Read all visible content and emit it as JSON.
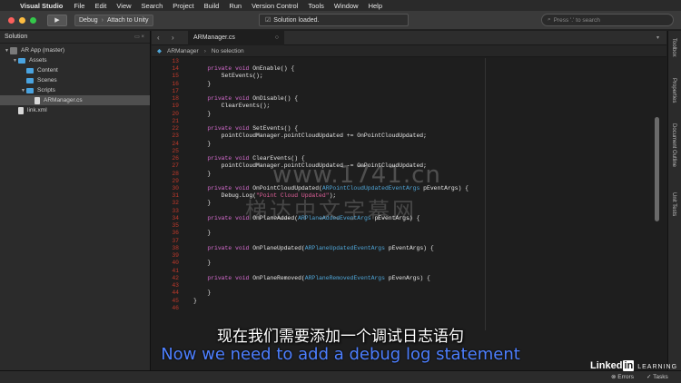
{
  "menubar": {
    "app": "Visual Studio",
    "items": [
      "File",
      "Edit",
      "View",
      "Search",
      "Project",
      "Build",
      "Run",
      "Version Control",
      "Tools",
      "Window",
      "Help"
    ]
  },
  "toolbar": {
    "config": "Debug",
    "target": "Attach to Unity",
    "status": "Solution loaded.",
    "search_placeholder": "Press '.' to search",
    "colors": {
      "close": "#fc605c",
      "minimize": "#fdbc40",
      "maximize": "#34c84a"
    }
  },
  "solution": {
    "title": "Solution",
    "items": [
      {
        "label": "AR App (master)",
        "indent": 0,
        "icon": "solution-icon",
        "twisty": "▼"
      },
      {
        "label": "Assets",
        "indent": 1,
        "icon": "folder-icon",
        "twisty": "▼"
      },
      {
        "label": "Content",
        "indent": 2,
        "icon": "folder-icon",
        "twisty": ""
      },
      {
        "label": "Scenes",
        "indent": 2,
        "icon": "folder-icon",
        "twisty": ""
      },
      {
        "label": "Scripts",
        "indent": 2,
        "icon": "folder-icon",
        "twisty": "▼"
      },
      {
        "label": "ARManager.cs",
        "indent": 3,
        "icon": "file-icon",
        "twisty": "",
        "selected": true
      },
      {
        "label": "link.xml",
        "indent": 1,
        "icon": "file-icon",
        "twisty": ""
      }
    ]
  },
  "editor": {
    "tab": "ARManager.cs",
    "path_class": "ARManager",
    "path_member": "No selection",
    "lines": [
      {
        "n": "13",
        "t": []
      },
      {
        "n": "14",
        "t": [
          [
            "    ",
            "src"
          ],
          [
            "private void",
            "kw"
          ],
          [
            " OnEnable() {",
            "src"
          ]
        ]
      },
      {
        "n": "15",
        "t": [
          [
            "        SetEvents();",
            "src"
          ]
        ]
      },
      {
        "n": "16",
        "t": [
          [
            "    }",
            "src"
          ]
        ]
      },
      {
        "n": "17",
        "t": []
      },
      {
        "n": "18",
        "t": [
          [
            "    ",
            "src"
          ],
          [
            "private void",
            "kw"
          ],
          [
            " OnDisable() {",
            "src"
          ]
        ]
      },
      {
        "n": "19",
        "t": [
          [
            "        ClearEvents();",
            "src"
          ]
        ]
      },
      {
        "n": "20",
        "t": [
          [
            "    }",
            "src"
          ]
        ]
      },
      {
        "n": "21",
        "t": []
      },
      {
        "n": "22",
        "t": [
          [
            "    ",
            "src"
          ],
          [
            "private void",
            "kw"
          ],
          [
            " SetEvents() {",
            "src"
          ]
        ]
      },
      {
        "n": "23",
        "t": [
          [
            "        pointCloudManager.pointCloudUpdated += OnPointCloudUpdated;",
            "src"
          ]
        ]
      },
      {
        "n": "24",
        "t": [
          [
            "    }",
            "src"
          ]
        ]
      },
      {
        "n": "25",
        "t": []
      },
      {
        "n": "26",
        "t": [
          [
            "    ",
            "src"
          ],
          [
            "private void",
            "kw"
          ],
          [
            " ClearEvents() {",
            "src"
          ]
        ]
      },
      {
        "n": "27",
        "t": [
          [
            "        pointCloudManager.pointCloudUpdated -= OnPointCloudUpdated;",
            "src"
          ]
        ]
      },
      {
        "n": "28",
        "t": [
          [
            "    }",
            "src"
          ]
        ]
      },
      {
        "n": "29",
        "t": []
      },
      {
        "n": "30",
        "t": [
          [
            "    ",
            "src"
          ],
          [
            "private void",
            "kw"
          ],
          [
            " OnPointCloudUpdated(",
            "src"
          ],
          [
            "ARPointCloudUpdatedEventArgs",
            "type"
          ],
          [
            " pEventArgs) {",
            "src"
          ]
        ]
      },
      {
        "n": "31",
        "t": [
          [
            "        Debug.Log(",
            "src"
          ],
          [
            "\"Point Cloud Updated\"",
            "str"
          ],
          [
            ");",
            "src"
          ]
        ]
      },
      {
        "n": "32",
        "t": [
          [
            "    }",
            "src"
          ]
        ]
      },
      {
        "n": "33",
        "t": []
      },
      {
        "n": "34",
        "t": [
          [
            "    ",
            "src"
          ],
          [
            "private void",
            "kw"
          ],
          [
            " OnPlaneAdded(",
            "src"
          ],
          [
            "ARPlaneAddedEventArgs",
            "type"
          ],
          [
            " pEventArgs) {",
            "src"
          ]
        ]
      },
      {
        "n": "35",
        "t": []
      },
      {
        "n": "36",
        "t": [
          [
            "    }",
            "src"
          ]
        ]
      },
      {
        "n": "37",
        "t": []
      },
      {
        "n": "38",
        "t": [
          [
            "    ",
            "src"
          ],
          [
            "private void",
            "kw"
          ],
          [
            " OnPlaneUpdated(",
            "src"
          ],
          [
            "ARPlaneUpdatedEventArgs",
            "type"
          ],
          [
            " pEventArgs) {",
            "src"
          ]
        ]
      },
      {
        "n": "39",
        "t": []
      },
      {
        "n": "40",
        "t": [
          [
            "    }",
            "src"
          ]
        ]
      },
      {
        "n": "41",
        "t": []
      },
      {
        "n": "42",
        "t": [
          [
            "    ",
            "src"
          ],
          [
            "private void",
            "kw"
          ],
          [
            " OnPlaneRemoved(",
            "src"
          ],
          [
            "ARPlaneRemovedEventArgs",
            "type"
          ],
          [
            " pEvenArgs) {",
            "src"
          ]
        ]
      },
      {
        "n": "43",
        "t": []
      },
      {
        "n": "44",
        "t": [
          [
            "    }",
            "src"
          ]
        ]
      },
      {
        "n": "45",
        "t": [
          [
            "}",
            "src"
          ]
        ]
      },
      {
        "n": "46",
        "t": []
      }
    ]
  },
  "rightdock": [
    "Toolbox",
    "Properties",
    "Document Outline",
    "Unit Tests"
  ],
  "bottombar": {
    "errors": "Errors",
    "tasks": "Tasks"
  },
  "overlay": {
    "subtitle_cn": "现在我们需要添加一个调试日志语句",
    "subtitle_en": "Now we need to add a debug log statement",
    "watermark": "www.1741.cn",
    "watermark_cn": "梯达中文字幕网",
    "logo_linked": "Linked",
    "logo_in": "in",
    "logo_learning": "LEARNING"
  }
}
